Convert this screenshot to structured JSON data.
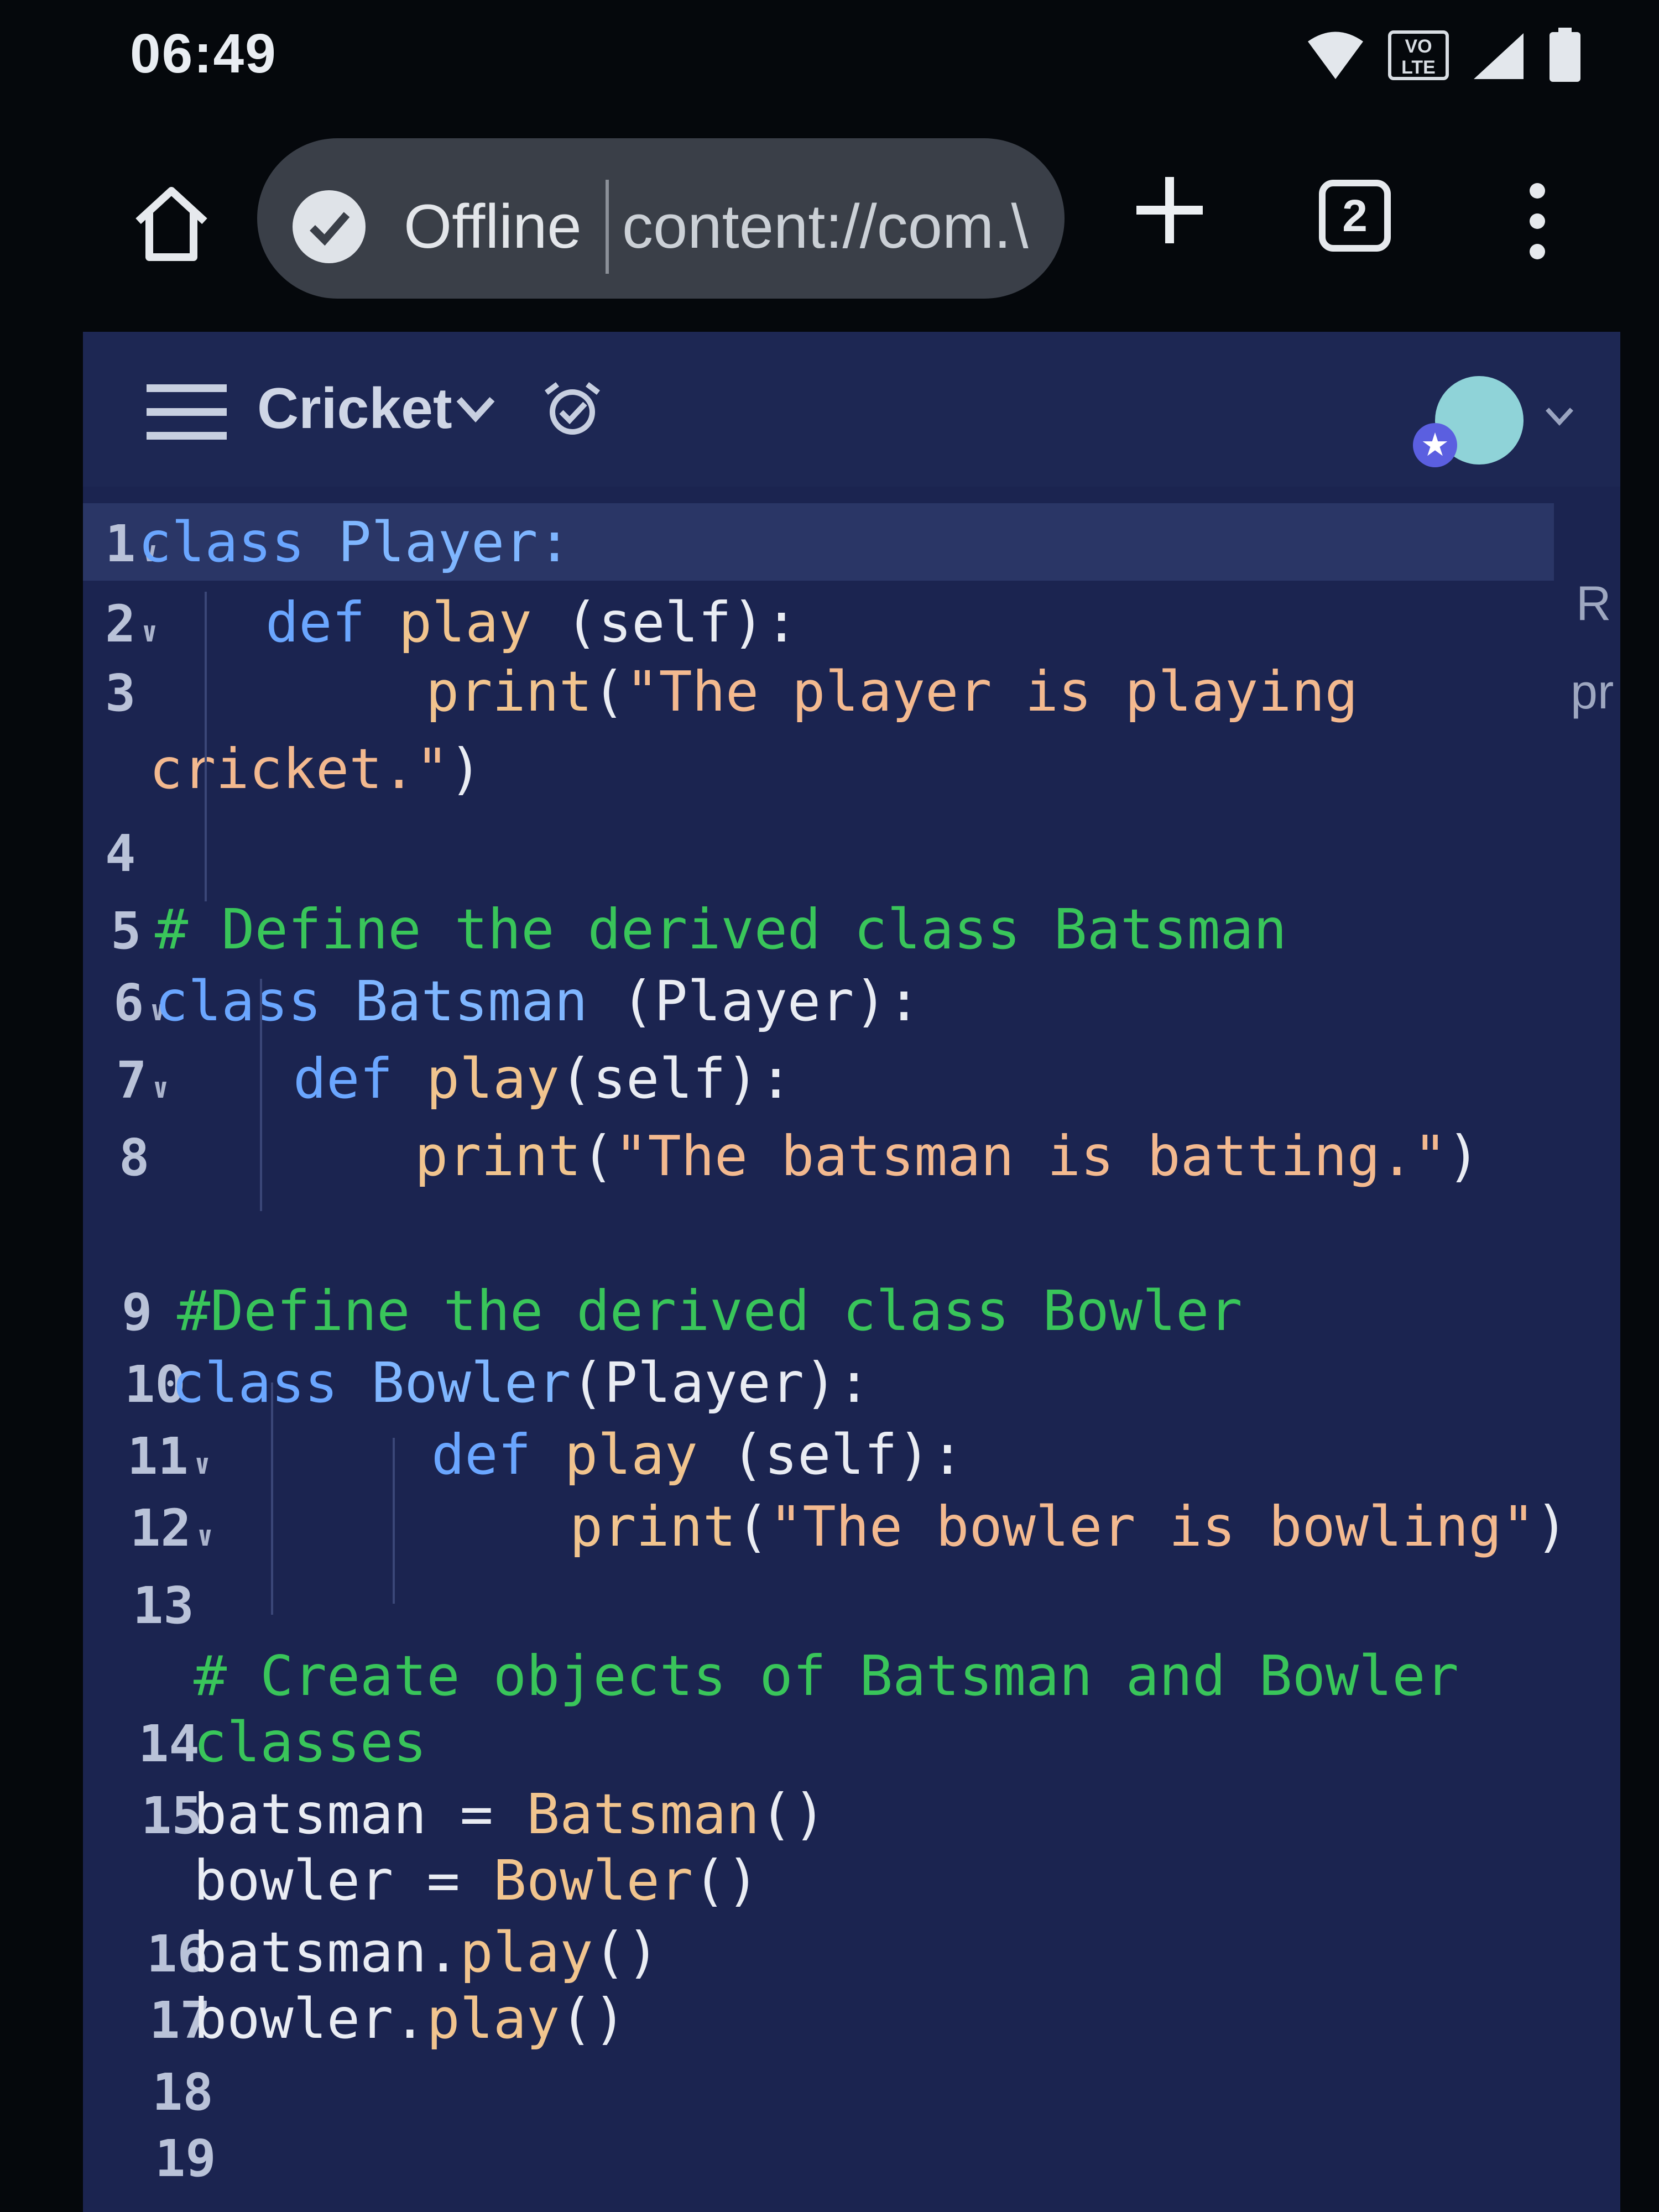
{
  "status_bar": {
    "time": "06:49",
    "network_badge": "VO LTE",
    "icons": [
      "wifi-icon",
      "volte-icon",
      "signal-icon",
      "battery-icon"
    ]
  },
  "browser": {
    "status_label": "Offline",
    "url": "content://com.\\",
    "tab_count": "2"
  },
  "app": {
    "project_name": "Cricket",
    "side_hints": [
      "R",
      "pr"
    ]
  },
  "editor": {
    "lines": [
      {
        "n": "1",
        "fold": true,
        "tokens": [
          {
            "t": "class ",
            "c": "kw"
          },
          {
            "t": "Player:",
            "c": "cls"
          }
        ]
      },
      {
        "n": "2",
        "fold": true,
        "tokens": [
          {
            "t": "def ",
            "c": "kw"
          },
          {
            "t": "play ",
            "c": "fn"
          },
          {
            "t": "(self):",
            "c": "pl"
          }
        ]
      },
      {
        "n": "3",
        "fold": false,
        "tokens": [
          {
            "t": "print",
            "c": "fn"
          },
          {
            "t": "(",
            "c": "pl"
          },
          {
            "t": "\"The player is playing",
            "c": "str"
          }
        ]
      },
      {
        "n": "",
        "fold": false,
        "tokens": [
          {
            "t": "cricket.\"",
            "c": "str"
          },
          {
            "t": ")",
            "c": "pl"
          }
        ]
      },
      {
        "n": "4",
        "fold": false,
        "tokens": []
      },
      {
        "n": "5",
        "fold": false,
        "tokens": [
          {
            "t": "# Define the derived class Batsman",
            "c": "cmt"
          }
        ]
      },
      {
        "n": "6",
        "fold": true,
        "tokens": [
          {
            "t": "class ",
            "c": "kw"
          },
          {
            "t": "Batsman ",
            "c": "cls"
          },
          {
            "t": "(Player):",
            "c": "pl"
          }
        ]
      },
      {
        "n": "7",
        "fold": true,
        "tokens": [
          {
            "t": "def ",
            "c": "kw"
          },
          {
            "t": "play",
            "c": "fn"
          },
          {
            "t": "(self):",
            "c": "pl"
          }
        ]
      },
      {
        "n": "8",
        "fold": false,
        "tokens": [
          {
            "t": "print",
            "c": "fn"
          },
          {
            "t": "(",
            "c": "pl"
          },
          {
            "t": "\"The batsman is batting.\"",
            "c": "str"
          },
          {
            "t": ")",
            "c": "pl"
          }
        ]
      },
      {
        "n": "9",
        "fold": false,
        "tokens": [
          {
            "t": "#Define the derived class Bowler",
            "c": "cmt"
          }
        ]
      },
      {
        "n": "10",
        "fold": false,
        "tokens": [
          {
            "t": "class ",
            "c": "kw"
          },
          {
            "t": "Bowler",
            "c": "cls"
          },
          {
            "t": "(Player):",
            "c": "pl"
          }
        ]
      },
      {
        "n": "11",
        "fold": true,
        "tokens": [
          {
            "t": "def ",
            "c": "kw"
          },
          {
            "t": "play ",
            "c": "fn"
          },
          {
            "t": "(self):",
            "c": "pl"
          }
        ]
      },
      {
        "n": "12",
        "fold": true,
        "tokens": [
          {
            "t": "print",
            "c": "fn"
          },
          {
            "t": "(",
            "c": "pl"
          },
          {
            "t": "\"The bowler is bowling\"",
            "c": "str"
          },
          {
            "t": ")",
            "c": "pl"
          }
        ]
      },
      {
        "n": "13",
        "fold": false,
        "tokens": []
      },
      {
        "n": "",
        "fold": false,
        "tokens": [
          {
            "t": "# Create objects of Batsman and Bowler",
            "c": "cmt"
          }
        ]
      },
      {
        "n": "14",
        "fold": false,
        "tokens": [
          {
            "t": "classes",
            "c": "cmt"
          }
        ]
      },
      {
        "n": "15",
        "fold": false,
        "tokens": [
          {
            "t": "batsman ",
            "c": "pl"
          },
          {
            "t": "= ",
            "c": "pl"
          },
          {
            "t": "Batsman",
            "c": "fn"
          },
          {
            "t": "()",
            "c": "pl"
          }
        ]
      },
      {
        "n": "",
        "fold": false,
        "tokens": [
          {
            "t": "bowler ",
            "c": "pl"
          },
          {
            "t": "= ",
            "c": "pl"
          },
          {
            "t": "Bowler",
            "c": "fn"
          },
          {
            "t": "()",
            "c": "pl"
          }
        ]
      },
      {
        "n": "16",
        "fold": false,
        "tokens": [
          {
            "t": "batsman.",
            "c": "pl"
          },
          {
            "t": "play",
            "c": "fn"
          },
          {
            "t": "()",
            "c": "pl"
          }
        ]
      },
      {
        "n": "17",
        "fold": false,
        "tokens": [
          {
            "t": "bowler.",
            "c": "pl"
          },
          {
            "t": "play",
            "c": "fn"
          },
          {
            "t": "()",
            "c": "pl"
          }
        ]
      },
      {
        "n": "18",
        "fold": false,
        "tokens": []
      },
      {
        "n": "19",
        "fold": false,
        "tokens": []
      }
    ]
  },
  "colors": {
    "keyword": "#6aa6ff",
    "string": "#f3b98f",
    "comment": "#39c55a",
    "editor_bg": "#1b2450"
  }
}
